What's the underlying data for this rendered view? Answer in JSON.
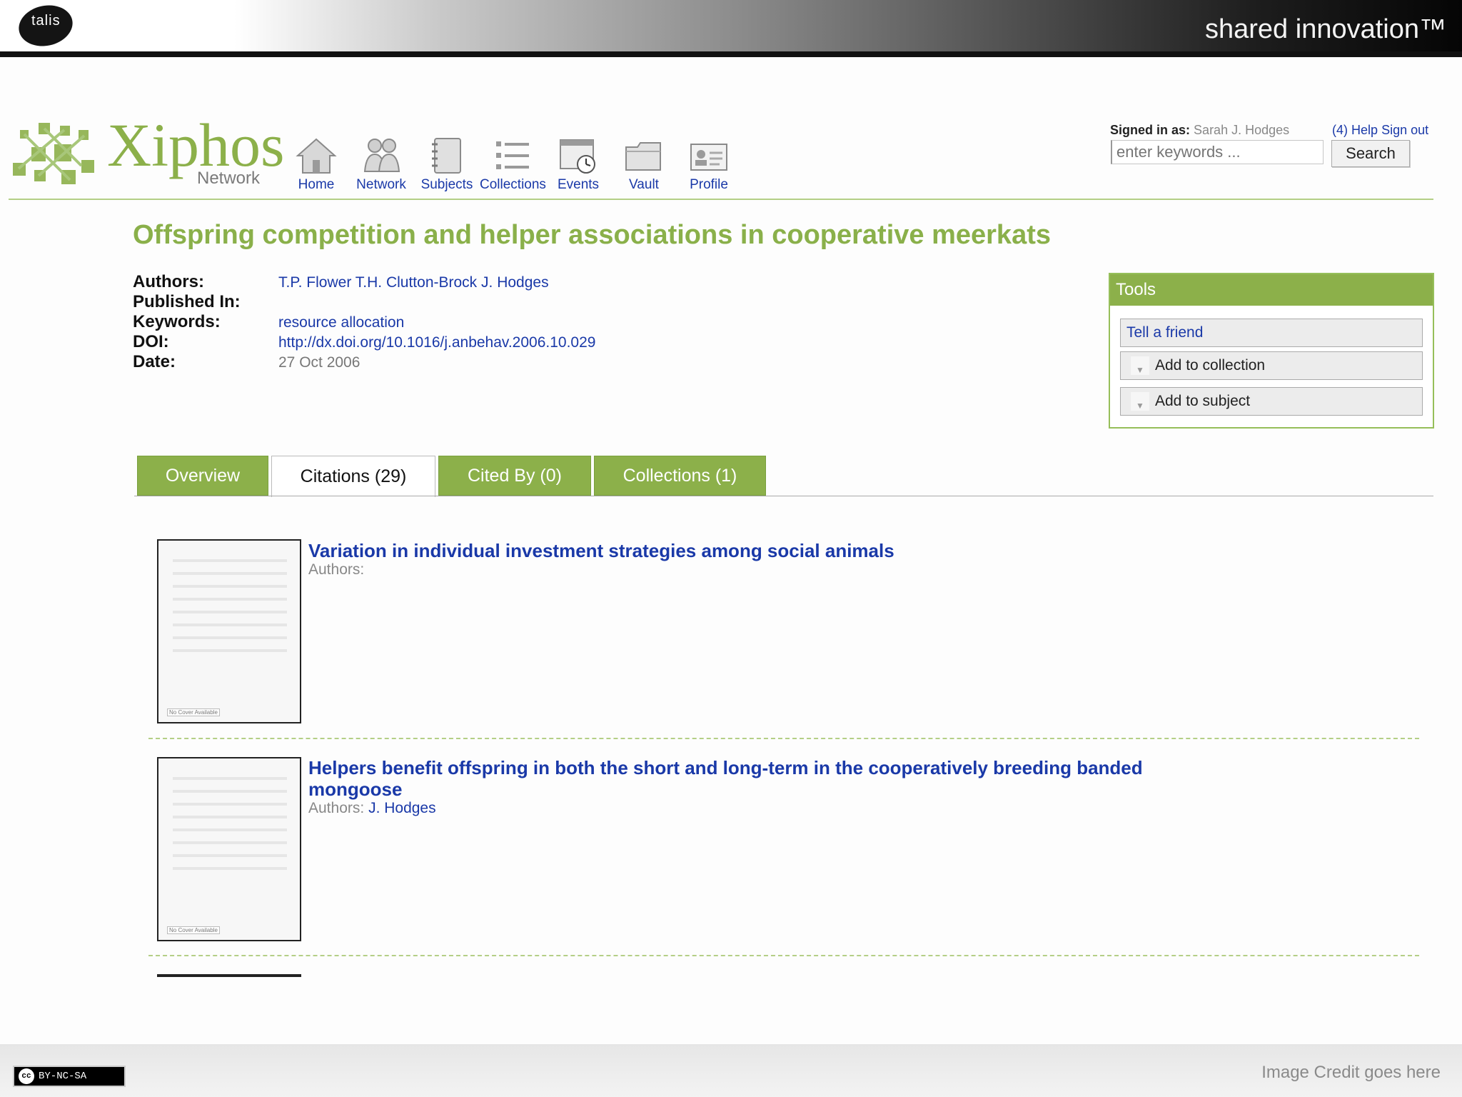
{
  "slide": {
    "brand": "talis",
    "tagline": "shared innovation™",
    "license": "BY-NC-SA",
    "credit": "Image Credit goes here"
  },
  "site": {
    "logo_word": "Xiphos",
    "logo_sub": "Network"
  },
  "nav": [
    {
      "label": "Home",
      "icon": "home-icon"
    },
    {
      "label": "Network",
      "icon": "people-icon"
    },
    {
      "label": "Subjects",
      "icon": "notebook-icon"
    },
    {
      "label": "Collections",
      "icon": "list-icon"
    },
    {
      "label": "Events",
      "icon": "calendar-clock-icon"
    },
    {
      "label": "Vault",
      "icon": "folder-icon"
    },
    {
      "label": "Profile",
      "icon": "profile-card-icon"
    }
  ],
  "user": {
    "signed_label": "Signed in as:",
    "name": "Sarah J. Hodges",
    "messages": "(4)",
    "help": "Help",
    "signout": "Sign out"
  },
  "search": {
    "placeholder": "enter keywords ...",
    "button": "Search"
  },
  "article": {
    "title": "Offspring competition and helper associations in cooperative meerkats",
    "authors_label": "Authors:",
    "authors": [
      "T.P. Flower",
      "T.H. Clutton-Brock",
      "J. Hodges"
    ],
    "published_label": "Published In:",
    "keywords_label": "Keywords:",
    "keywords": "resource allocation",
    "doi_label": "DOI:",
    "doi": "http://dx.doi.org/10.1016/j.anbehav.2006.10.029",
    "date_label": "Date:",
    "date": "27 Oct 2006"
  },
  "tools": {
    "title": "Tools",
    "tell": "Tell a friend",
    "add_collection": "Add to collection",
    "add_subject": "Add to subject"
  },
  "tabs": [
    {
      "label": "Overview",
      "active": false
    },
    {
      "label": "Citations (29)",
      "active": true
    },
    {
      "label": "Cited By (0)",
      "active": false
    },
    {
      "label": "Collections (1)",
      "active": false
    }
  ],
  "citations": [
    {
      "title": "Variation in individual investment strategies among social animals",
      "authors_label": "Authors:",
      "authors": "",
      "cover": "No Cover Available"
    },
    {
      "title": "Helpers benefit offspring in both the short and long-term in the cooperatively breeding banded mongoose",
      "authors_label": "Authors:",
      "authors": "J. Hodges",
      "cover": "No Cover Available"
    }
  ],
  "colors": {
    "accent_green": "#8cb04a",
    "link_blue": "#1a39a8"
  }
}
